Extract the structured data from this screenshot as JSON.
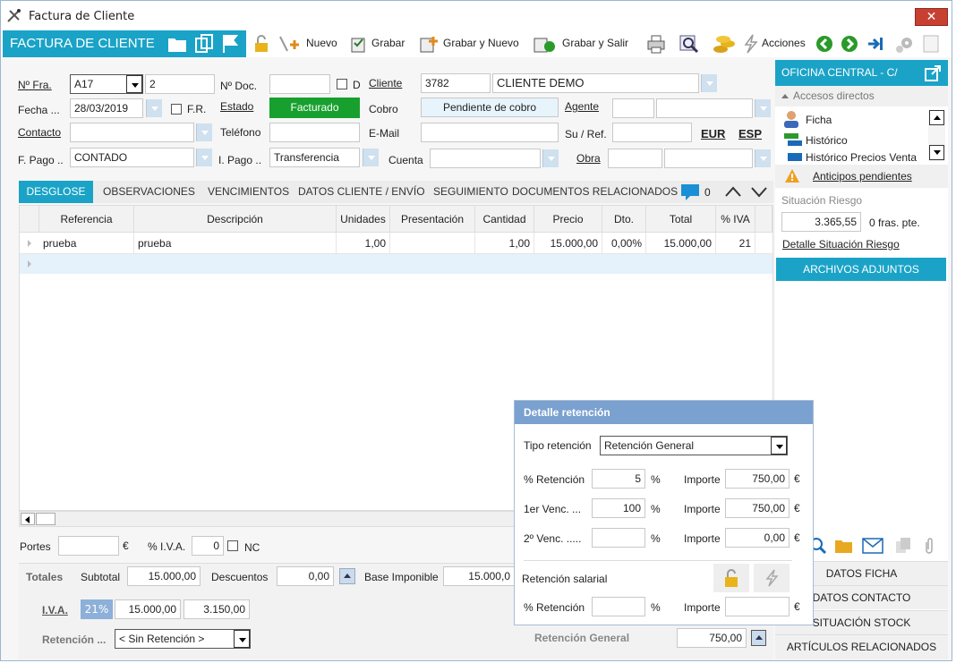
{
  "window": {
    "title": "Factura de Cliente",
    "close": "✕"
  },
  "toolbar": {
    "title": "FACTURA DE CLIENTE",
    "nuevo": "Nuevo",
    "grabar": "Grabar",
    "grabar_nuevo": "Grabar y Nuevo",
    "grabar_salir": "Grabar y Salir",
    "acciones": "Acciones"
  },
  "header": {
    "nfra_label": "Nº Fra.",
    "serie": "A17",
    "numero": "2",
    "ndoc_label": "Nº Doc.",
    "ndoc_value": "",
    "d_label": "D",
    "cliente_label": "Cliente",
    "cliente_code": "3782",
    "cliente_name": "CLIENTE DEMO",
    "fecha_label": "Fecha ...",
    "fecha": "28/03/2019",
    "fr_label": "F.R.",
    "estado_label": "Estado",
    "estado": "Facturado",
    "cobro_label": "Cobro",
    "cobro": "Pendiente de cobro",
    "agente_label": "Agente",
    "contacto_label": "Contacto",
    "telefono_label": "Teléfono",
    "email_label": "E-Mail",
    "suref_label": "Su / Ref.",
    "eur": "EUR",
    "esp": "ESP",
    "fpago_label": "F. Pago ..",
    "fpago": "CONTADO",
    "ipago_label": "I. Pago ..",
    "ipago": "Transferencia",
    "cuenta_label": "Cuenta",
    "obra_label": "Obra"
  },
  "tabs": [
    "DESGLOSE",
    "OBSERVACIONES",
    "VENCIMIENTOS",
    "DATOS CLIENTE / ENVÍO",
    "SEGUIMIENTO",
    "DOCUMENTOS RELACIONADOS"
  ],
  "comments_count": "0",
  "grid": {
    "columns": [
      "Referencia",
      "Descripción",
      "Unidades",
      "Presentación",
      "Cantidad",
      "Precio",
      "Dto.",
      "Total",
      "% IVA"
    ],
    "rows": [
      {
        "ref": "prueba",
        "desc": "prueba",
        "unidades": "1,00",
        "presentacion": "",
        "cantidad": "1,00",
        "precio": "15.000,00",
        "dto": "0,00%",
        "total": "15.000,00",
        "iva": "21"
      }
    ]
  },
  "footer": {
    "portes_label": "Portes",
    "euro": "€",
    "piva_label": "% I.V.A.",
    "piva_value": "0",
    "nc_label": "NC",
    "totales_label": "Totales",
    "subtotal_label": "Subtotal",
    "subtotal": "15.000,00",
    "descuentos_label": "Descuentos",
    "descuentos": "0,00",
    "base_label": "Base Imponible",
    "base": "15.000,0",
    "iva_label": "I.V.A.",
    "iva_rate": "21%",
    "iva_base": "15.000,00",
    "iva_amount": "3.150,00",
    "retencion_label": "Retención ...",
    "retencion_select": "< Sin Retención >",
    "ret_general_label": "Retención General",
    "ret_general": "750,00"
  },
  "popup": {
    "title": "Detalle retención",
    "tipo_label": "Tipo retención",
    "tipo": "Retención General",
    "pret_label": "% Retención",
    "pret": "5",
    "pct": "%",
    "importe_label": "Importe",
    "importe1": "750,00",
    "venc1_label": "1er Venc. ...",
    "venc1": "100",
    "importe2": "750,00",
    "venc2_label": "2º Venc. .....",
    "venc2": "",
    "importe3": "0,00",
    "salarial_label": "Retención salarial",
    "sal_pret_label": "% Retención",
    "sal_importe_label": "Importe",
    "euro": "€"
  },
  "right": {
    "office": "OFICINA CENTRAL - C/",
    "accesos": "Accesos directos",
    "items": [
      "Ficha",
      "Histórico",
      "Histórico Precios Venta"
    ],
    "anticipos": "Anticipos pendientes",
    "riesgo_label": "Situación Riesgo",
    "riesgo_value": "3.365,55",
    "fras": "0 fras. pte.",
    "detalle_riesgo": "Detalle Situación Riesgo",
    "adjuntos": "ARCHIVOS ADJUNTOS",
    "datos_ficha": "DATOS FICHA",
    "datos_contacto": "DATOS CONTACTO",
    "situacion_stock": "SITUACIÓN STOCK",
    "articulos": "ARTÍCULOS RELACIONADOS"
  }
}
